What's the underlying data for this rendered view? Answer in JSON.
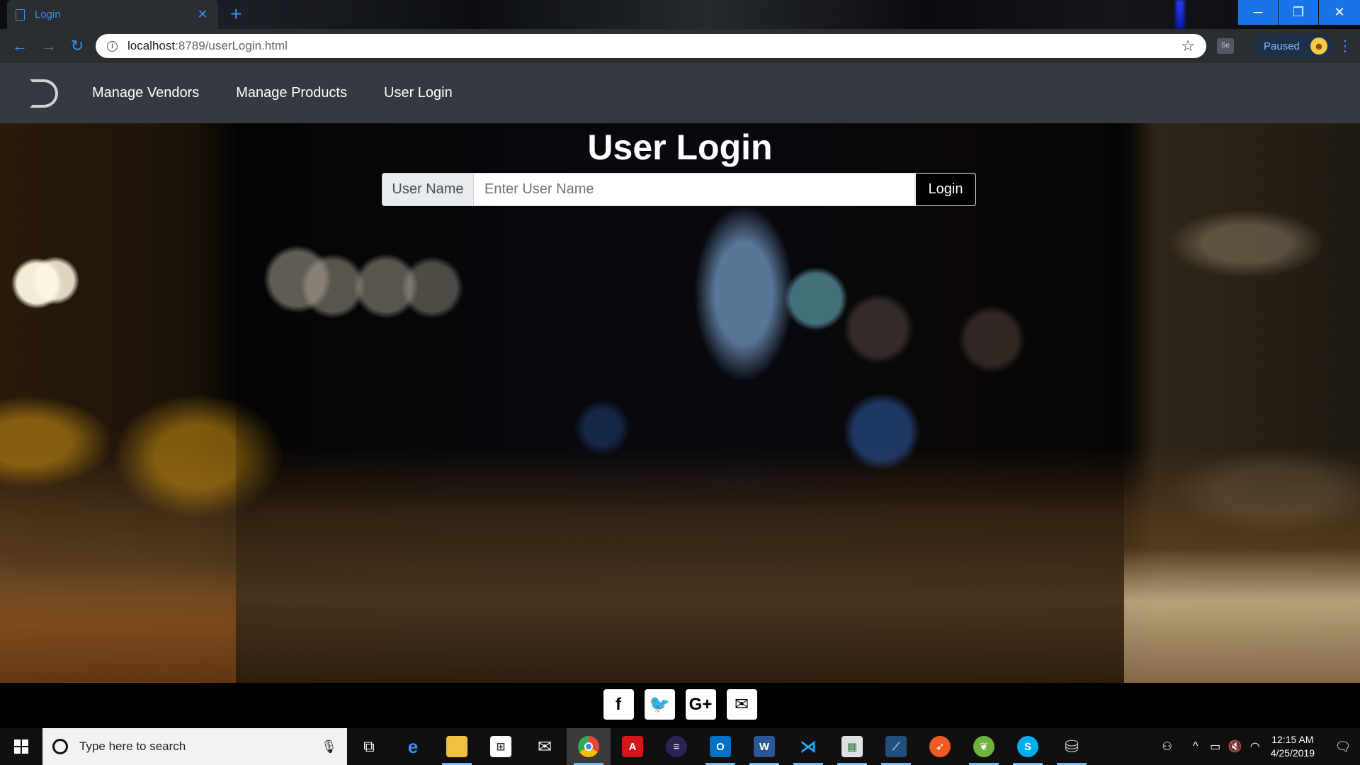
{
  "browser": {
    "tab_title": "Login",
    "tab_close": "✕",
    "new_tab": "+",
    "url_host": "localhost",
    "url_rest": ":8789/userLogin.html",
    "paused_label": "Paused",
    "minimize": "─",
    "maximize": "❐",
    "close": "✕"
  },
  "nav": {
    "links": [
      "Manage Vendors",
      "Manage Products",
      "User Login"
    ]
  },
  "login": {
    "title": "User Login",
    "input_label": "User Name",
    "input_placeholder": "Enter User Name",
    "input_value": "",
    "button_label": "Login"
  },
  "footer": {
    "social": [
      {
        "name": "facebook-icon",
        "glyph": "f"
      },
      {
        "name": "twitter-icon",
        "glyph": "🐦"
      },
      {
        "name": "google-plus-icon",
        "glyph": "G+"
      },
      {
        "name": "email-icon",
        "glyph": "✉"
      }
    ]
  },
  "taskbar": {
    "search_placeholder": "Type here to search",
    "time": "12:15 AM",
    "date": "4/25/2019"
  },
  "colors": {
    "accent": "#3d8cf0",
    "navbar": "#343a40",
    "window_controls": "#1a73e8"
  }
}
